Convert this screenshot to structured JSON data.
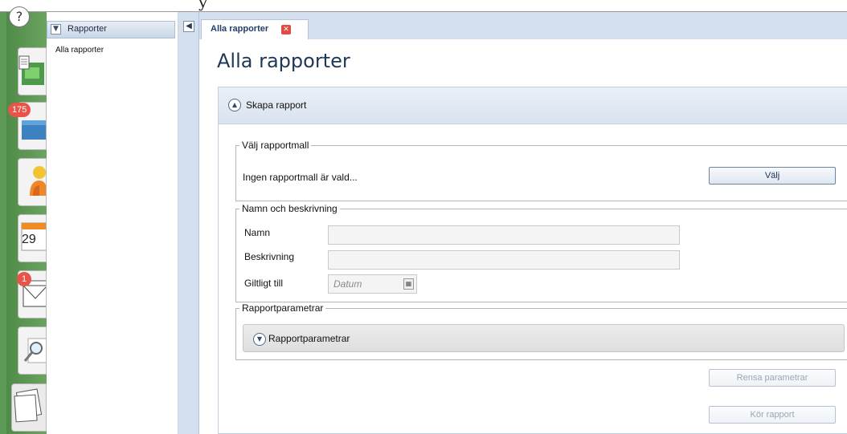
{
  "top": {
    "partial_heading": "y"
  },
  "rail": {
    "help_glyph": "?",
    "items": [
      {
        "icon": "report-document-icon",
        "badge": ""
      },
      {
        "icon": "inbox-tray-icon",
        "badge": "175"
      },
      {
        "icon": "user-person-icon",
        "badge": ""
      },
      {
        "icon": "calendar-icon",
        "badge": "",
        "label": "29"
      },
      {
        "icon": "mail-envelope-icon",
        "badge": "1"
      },
      {
        "icon": "search-magnifier-icon",
        "badge": ""
      },
      {
        "icon": "reports-pages-icon",
        "badge": ""
      }
    ]
  },
  "nav": {
    "header": "Rapporter",
    "items": [
      {
        "label": "Alla rapporter"
      }
    ]
  },
  "tabs": [
    {
      "label": "Alla rapporter",
      "closable": true
    }
  ],
  "main": {
    "title": "Alla rapporter",
    "create_section": {
      "label": "Skapa rapport"
    },
    "template_group": {
      "legend": "Välj rapportmall",
      "status": "Ingen rapportmall är vald...",
      "choose_button": "Välj"
    },
    "name_group": {
      "legend": "Namn och beskrivning",
      "name_label": "Namn",
      "name_value": "",
      "description_label": "Beskrivning",
      "description_value": "",
      "valid_until_label": "Giltligt till",
      "date_placeholder": "Datum"
    },
    "params_group": {
      "legend": "Rapportparametrar",
      "expander_label": "Rapportparametrar"
    },
    "clear_button": "Rensa parametrar",
    "run_button": "Kör rapport"
  },
  "colors": {
    "rail_green": "#5d9a55",
    "badge_red": "#e8534a",
    "panel_blue": "#d4e0ef",
    "title_blue": "#1d3858"
  }
}
